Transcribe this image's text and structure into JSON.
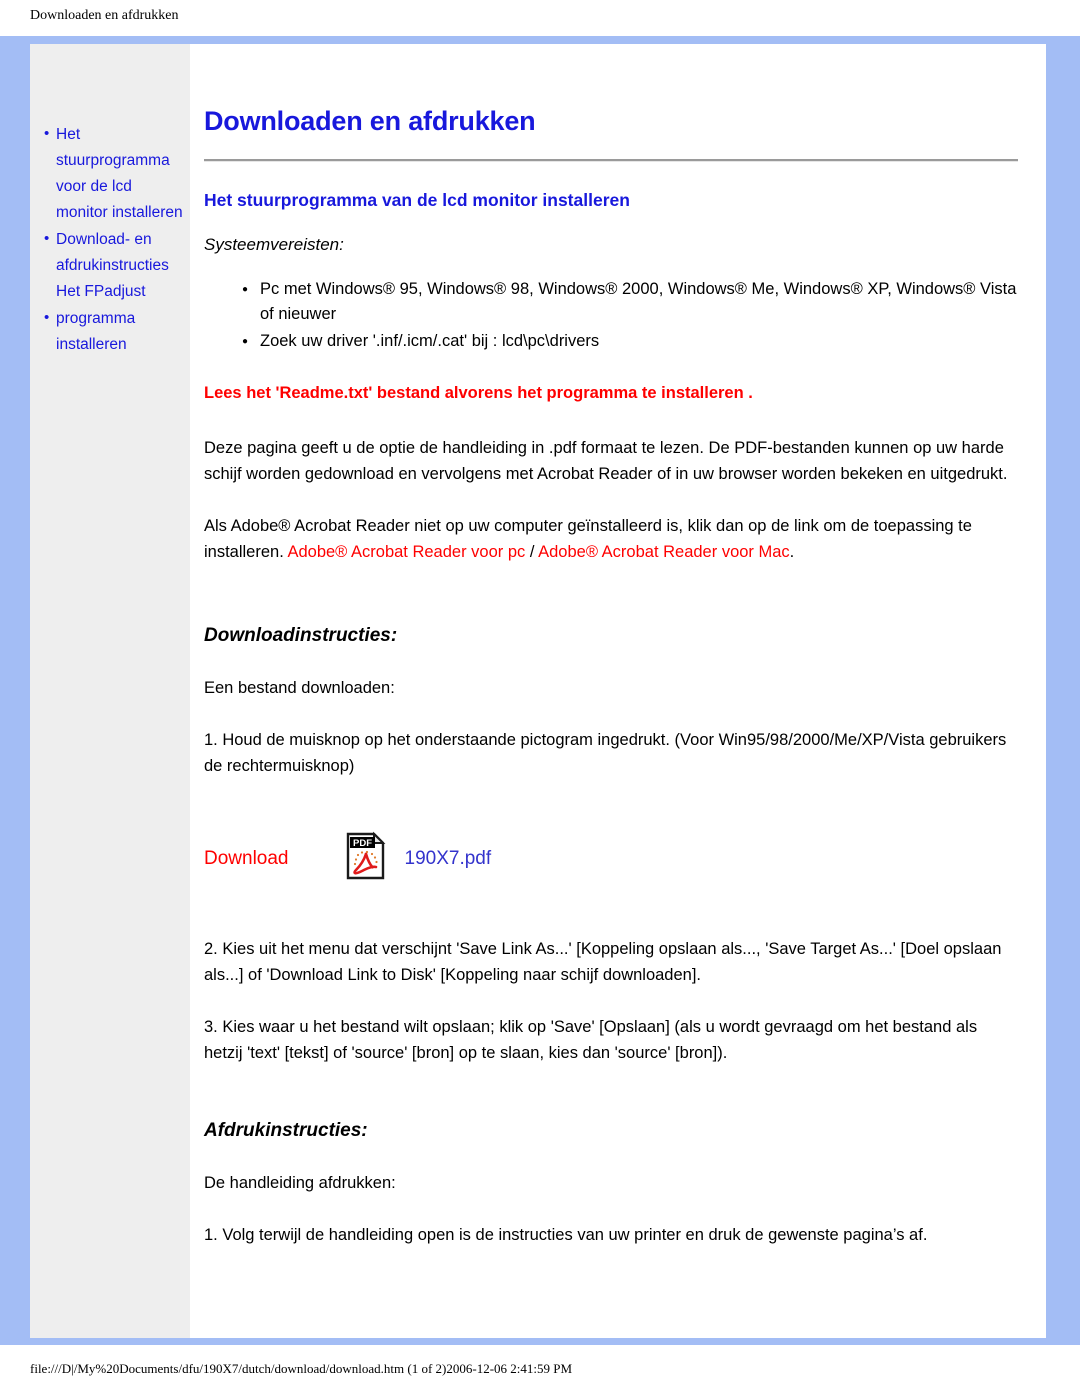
{
  "browser": {
    "print_header": "Downloaden en afdrukken",
    "status_bar": "file:///D|/My%20Documents/dfu/190X7/dutch/download/download.htm (1 of 2)2006-12-06 2:41:59 PM"
  },
  "colors": {
    "frame_blue": "#a3bdf5",
    "link_blue": "#1818dc",
    "warning_red": "#fe0000",
    "sidebar_bg": "#eeeeee"
  },
  "sidebar": {
    "items": [
      {
        "label": "Het stuurprogramma voor de lcd monitor installeren"
      },
      {
        "label": "Download- en afdrukinstructies Het FPadjust"
      },
      {
        "label": "programma installeren"
      }
    ]
  },
  "main": {
    "title": "Downloaden en afdrukken",
    "section_title": "Het stuurprogramma van de lcd monitor installeren",
    "sysreq_label": "Systeemvereisten:",
    "requirements": [
      "Pc met Windows® 95, Windows® 98, Windows® 2000, Windows® Me, Windows® XP, Windows® Vista of nieuwer",
      "Zoek uw driver '.inf/.icm/.cat' bij : lcd\\pc\\drivers"
    ],
    "readme_warning": "Lees het 'Readme.txt' bestand alvorens het programma te installeren .",
    "paragraph_pdf": "Deze pagina geeft u de optie de handleiding in .pdf formaat te lezen. De PDF-bestanden kunnen op uw harde schijf worden gedownload en vervolgens met Acrobat Reader of in uw browser worden bekeken en uitgedrukt.",
    "paragraph_acrobat_pre": "Als Adobe® Acrobat Reader niet op uw computer geïnstalleerd is, klik dan op de link om de toepassing te installeren. ",
    "acrobat_link_pc": "Adobe® Acrobat Reader voor pc",
    "acrobat_separator": " / ",
    "acrobat_link_mac": "Adobe® Acrobat Reader voor Mac",
    "acrobat_tail": ".",
    "download_section": {
      "heading": "Downloadinstructies:",
      "intro": "Een bestand downloaden:",
      "step1": "1. Houd de muisknop op het onderstaande pictogram ingedrukt. (Voor Win95/98/2000/Me/XP/Vista gebruikers de rechtermuisknop)",
      "download_label": "Download",
      "pdf_icon_label": "PDF",
      "pdf_file_name": "190X7.pdf",
      "step2": "2. Kies uit het menu dat verschijnt 'Save Link As...' [Koppeling opslaan als..., 'Save Target As...' [Doel opslaan als...] of 'Download Link to Disk' [Koppeling naar schijf downloaden].",
      "step3": "3. Kies waar u het bestand wilt opslaan; klik op 'Save' [Opslaan] (als u wordt gevraagd om het bestand als hetzij 'text' [tekst] of 'source' [bron] op te slaan, kies dan 'source' [bron])."
    },
    "print_section": {
      "heading": "Afdrukinstructies:",
      "intro": "De handleiding afdrukken:",
      "step1": "1. Volg terwijl de handleiding open is de instructies van uw printer en druk de gewenste pagina’s af."
    }
  }
}
